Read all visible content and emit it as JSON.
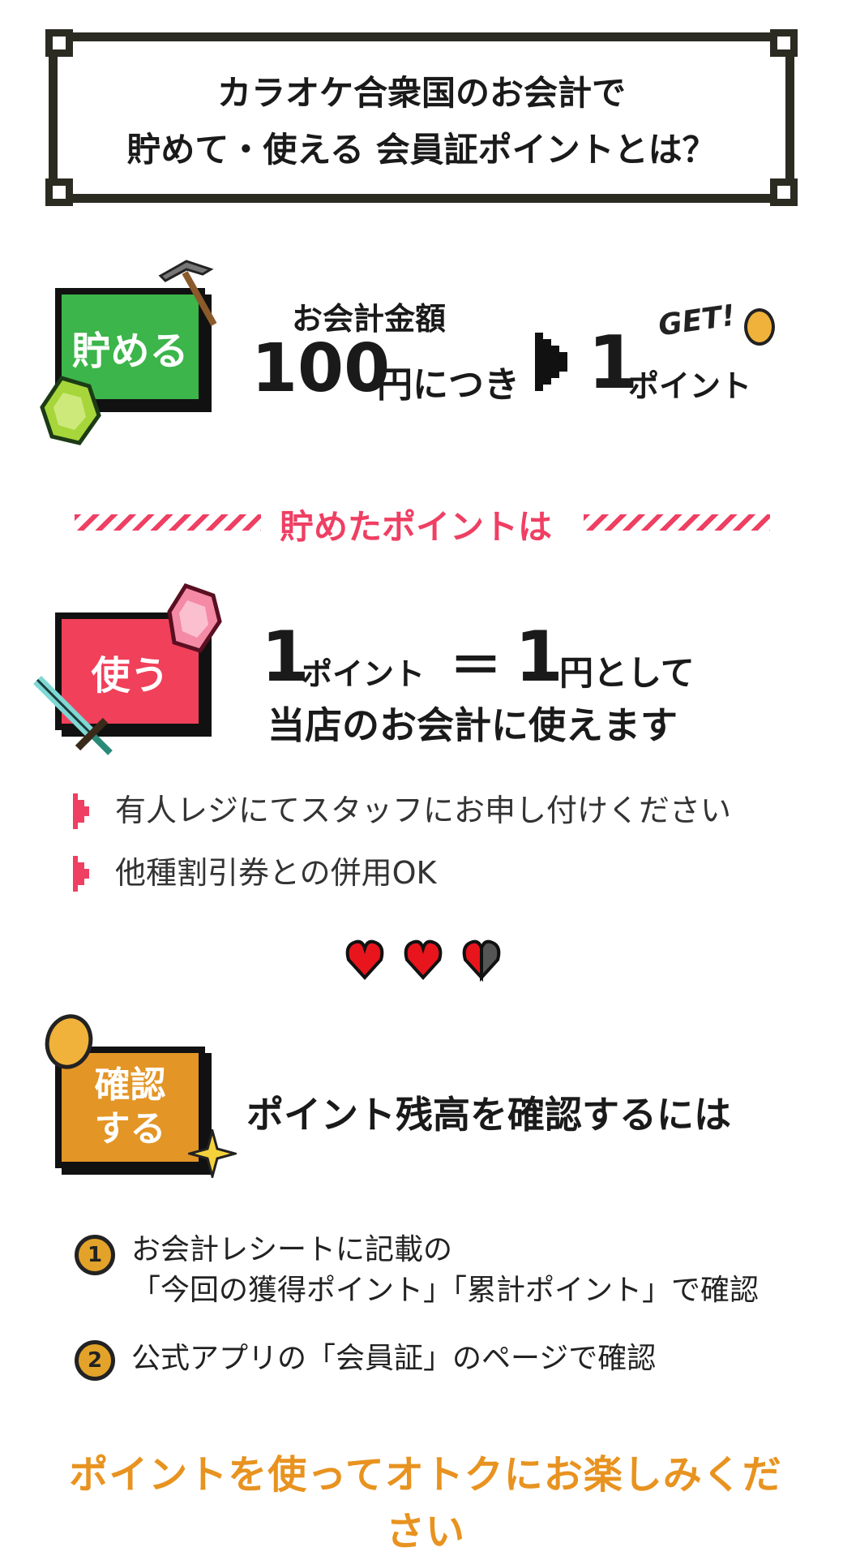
{
  "title": {
    "line1": "カラオケ合衆国のお会計で",
    "line2": "貯めて・使える 会員証ポイントとは？"
  },
  "earn": {
    "badge": "貯める",
    "label_amount": "お会計金額",
    "amount": "100",
    "per": "円につき",
    "points": "1",
    "points_unit": "ポイント",
    "get": "GET!"
  },
  "divider": {
    "text": "貯めたポイントは"
  },
  "use": {
    "badge": "使う",
    "points": "1",
    "points_unit": "ポイント",
    "equals": "＝",
    "yen": "1",
    "yen_unit": "円として",
    "line2": "当店のお会計に使えます",
    "bullets": [
      "有人レジにてスタッフにお申し付けください",
      "他種割引券との併用OK"
    ]
  },
  "check": {
    "badge_line1": "確認",
    "badge_line2": "する",
    "heading": "ポイント残高を確認するには",
    "items": [
      {
        "num": "1",
        "line1": "お会計レシートに記載の",
        "line2": "「今回の獲得ポイント」「累計ポイント」で確認"
      },
      {
        "num": "2",
        "line1": "公式アプリの「会員証」のページで確認"
      }
    ]
  },
  "footer": "ポイントを使ってオトクにお楽しみください",
  "colors": {
    "green": "#3cb54a",
    "pink": "#f0405a",
    "orange": "#e39526",
    "dark": "#2b2b22"
  },
  "icons": [
    "pickaxe-icon",
    "emerald-gem-icon",
    "coin-icon",
    "ruby-gem-icon",
    "sword-icon",
    "heart-icon",
    "sparkle-icon"
  ]
}
